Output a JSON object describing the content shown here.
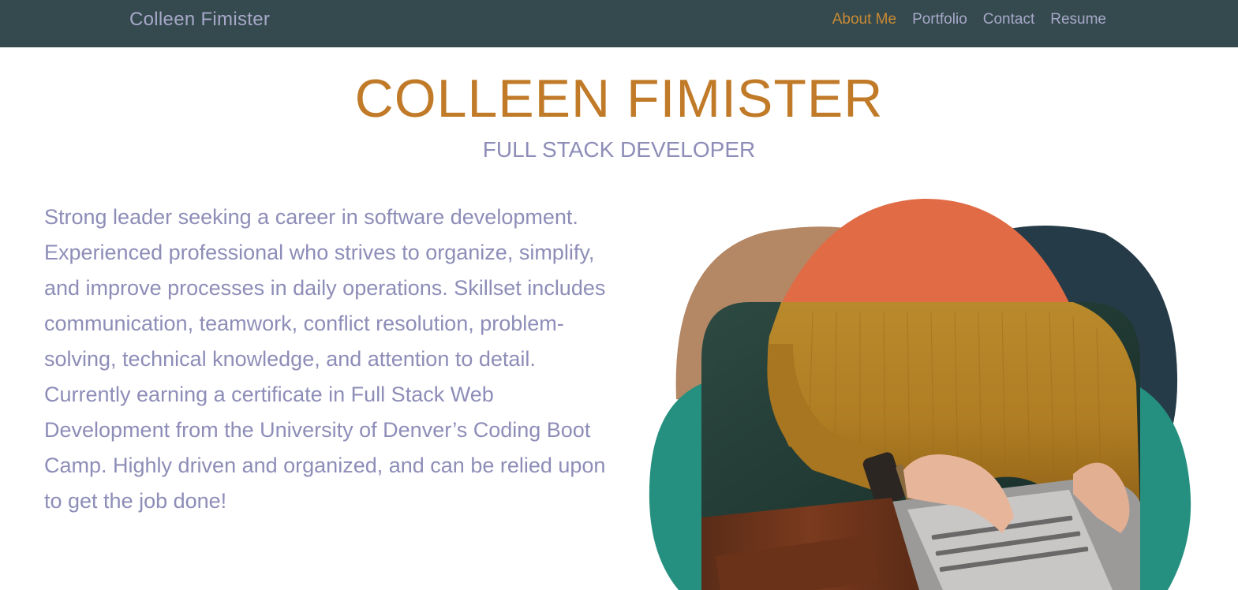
{
  "navbar": {
    "brand": "Colleen Fimister",
    "links": [
      {
        "label": "About Me",
        "active": true
      },
      {
        "label": "Portfolio",
        "active": false
      },
      {
        "label": "Contact",
        "active": false
      },
      {
        "label": "Resume",
        "active": false
      }
    ]
  },
  "hero": {
    "name": "COLLEEN FIMISTER",
    "role": "FULL STACK DEVELOPER"
  },
  "about": {
    "bio": "Strong leader seeking a career in software development. Experienced professional who strives to organize, simplify, and improve processes in daily operations. Skillset includes communication, teamwork, conflict resolution, problem-solving, technical knowledge, and attention to detail. Currently earning a certificate in Full Stack Web Development from the University of Denver’s Coding Boot Camp. Highly driven and organized, and can be relied upon to get the job done!"
  },
  "colors": {
    "navbar_bg": "#354a4e",
    "accent": "#c07a28",
    "text_muted": "#8d8db8",
    "blob_tan": "#b48765",
    "blob_orange": "#e06b45",
    "blob_navy": "#263b48",
    "blob_teal": "#25907f"
  }
}
